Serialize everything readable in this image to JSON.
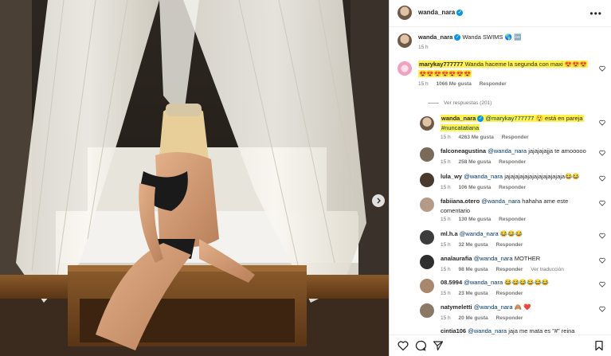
{
  "post": {
    "author": "wanda_nara",
    "caption_user": "wanda_nara",
    "caption_text": "Wanda SWIMS 🌎 🆒",
    "caption_time": "15 h"
  },
  "comments": [
    {
      "user": "marykay777777",
      "text": "Wanda haceme la segunda con maxi 😍😍😍",
      "text2": "😍😍😍😍😍😍😍",
      "time": "15 h",
      "likes": "1066 Me gusta",
      "reply": "Responder",
      "highlighted": true
    }
  ],
  "replies_toggle": "Ver respuestas (201)",
  "replies": [
    {
      "user": "wanda_nara",
      "mention": "@marykay777777",
      "text": "😲 está en pareja",
      "text2": "#nuncatatiana",
      "time": "15 h",
      "likes": "4263 Me gusta",
      "reply": "Responder"
    },
    {
      "user": "falconeagustina",
      "mention": "@wanda_nara",
      "text": "jajajajajja te amooooo",
      "time": "15 h",
      "likes": "258 Me gusta",
      "reply": "Responder"
    },
    {
      "user": "lula_wy",
      "mention": "@wanda_nara",
      "text": "jajajajajajajajajajajajaja😂😂",
      "time": "15 h",
      "likes": "106 Me gusta",
      "reply": "Responder"
    },
    {
      "user": "fabiiana.otero",
      "mention": "@wanda_nara",
      "text": "hahaha ame este",
      "text2": "comentario",
      "time": "15 h",
      "likes": "130 Me gusta",
      "reply": "Responder"
    },
    {
      "user": "ml.h.a",
      "mention": "@wanda_nara",
      "text": "😂😂😂",
      "time": "15 h",
      "likes": "32 Me gusta",
      "reply": "Responder"
    },
    {
      "user": "analaurafia",
      "mention": "@wanda_nara",
      "text": "MOTHER",
      "time": "15 h",
      "likes": "98 Me gusta",
      "reply": "Responder",
      "extra": "Ver traducción"
    },
    {
      "user": "08.5994",
      "mention": "@wanda_nara",
      "text": "😂😂😂😂😂😂",
      "time": "15 h",
      "likes": "23 Me gusta",
      "reply": "Responder"
    },
    {
      "user": "natymeletti",
      "mention": "@wanda_nara",
      "text": "🙈 ❤️",
      "time": "15 h",
      "likes": "20 Me gusta",
      "reply": "Responder"
    },
    {
      "user": "cintia106",
      "mention": "@wanda_nara",
      "text": "jaja me mata es \"#\" reina"
    }
  ],
  "colors": {
    "highlight": "#fff34a",
    "mention": "#00376b",
    "verified": "#0095f6",
    "meta": "#737373"
  },
  "icons": {
    "heart": "heart-icon",
    "comment": "comment-icon",
    "share": "share-icon",
    "save": "bookmark-icon",
    "more": "more-icon",
    "next": "chevron-right-icon"
  }
}
